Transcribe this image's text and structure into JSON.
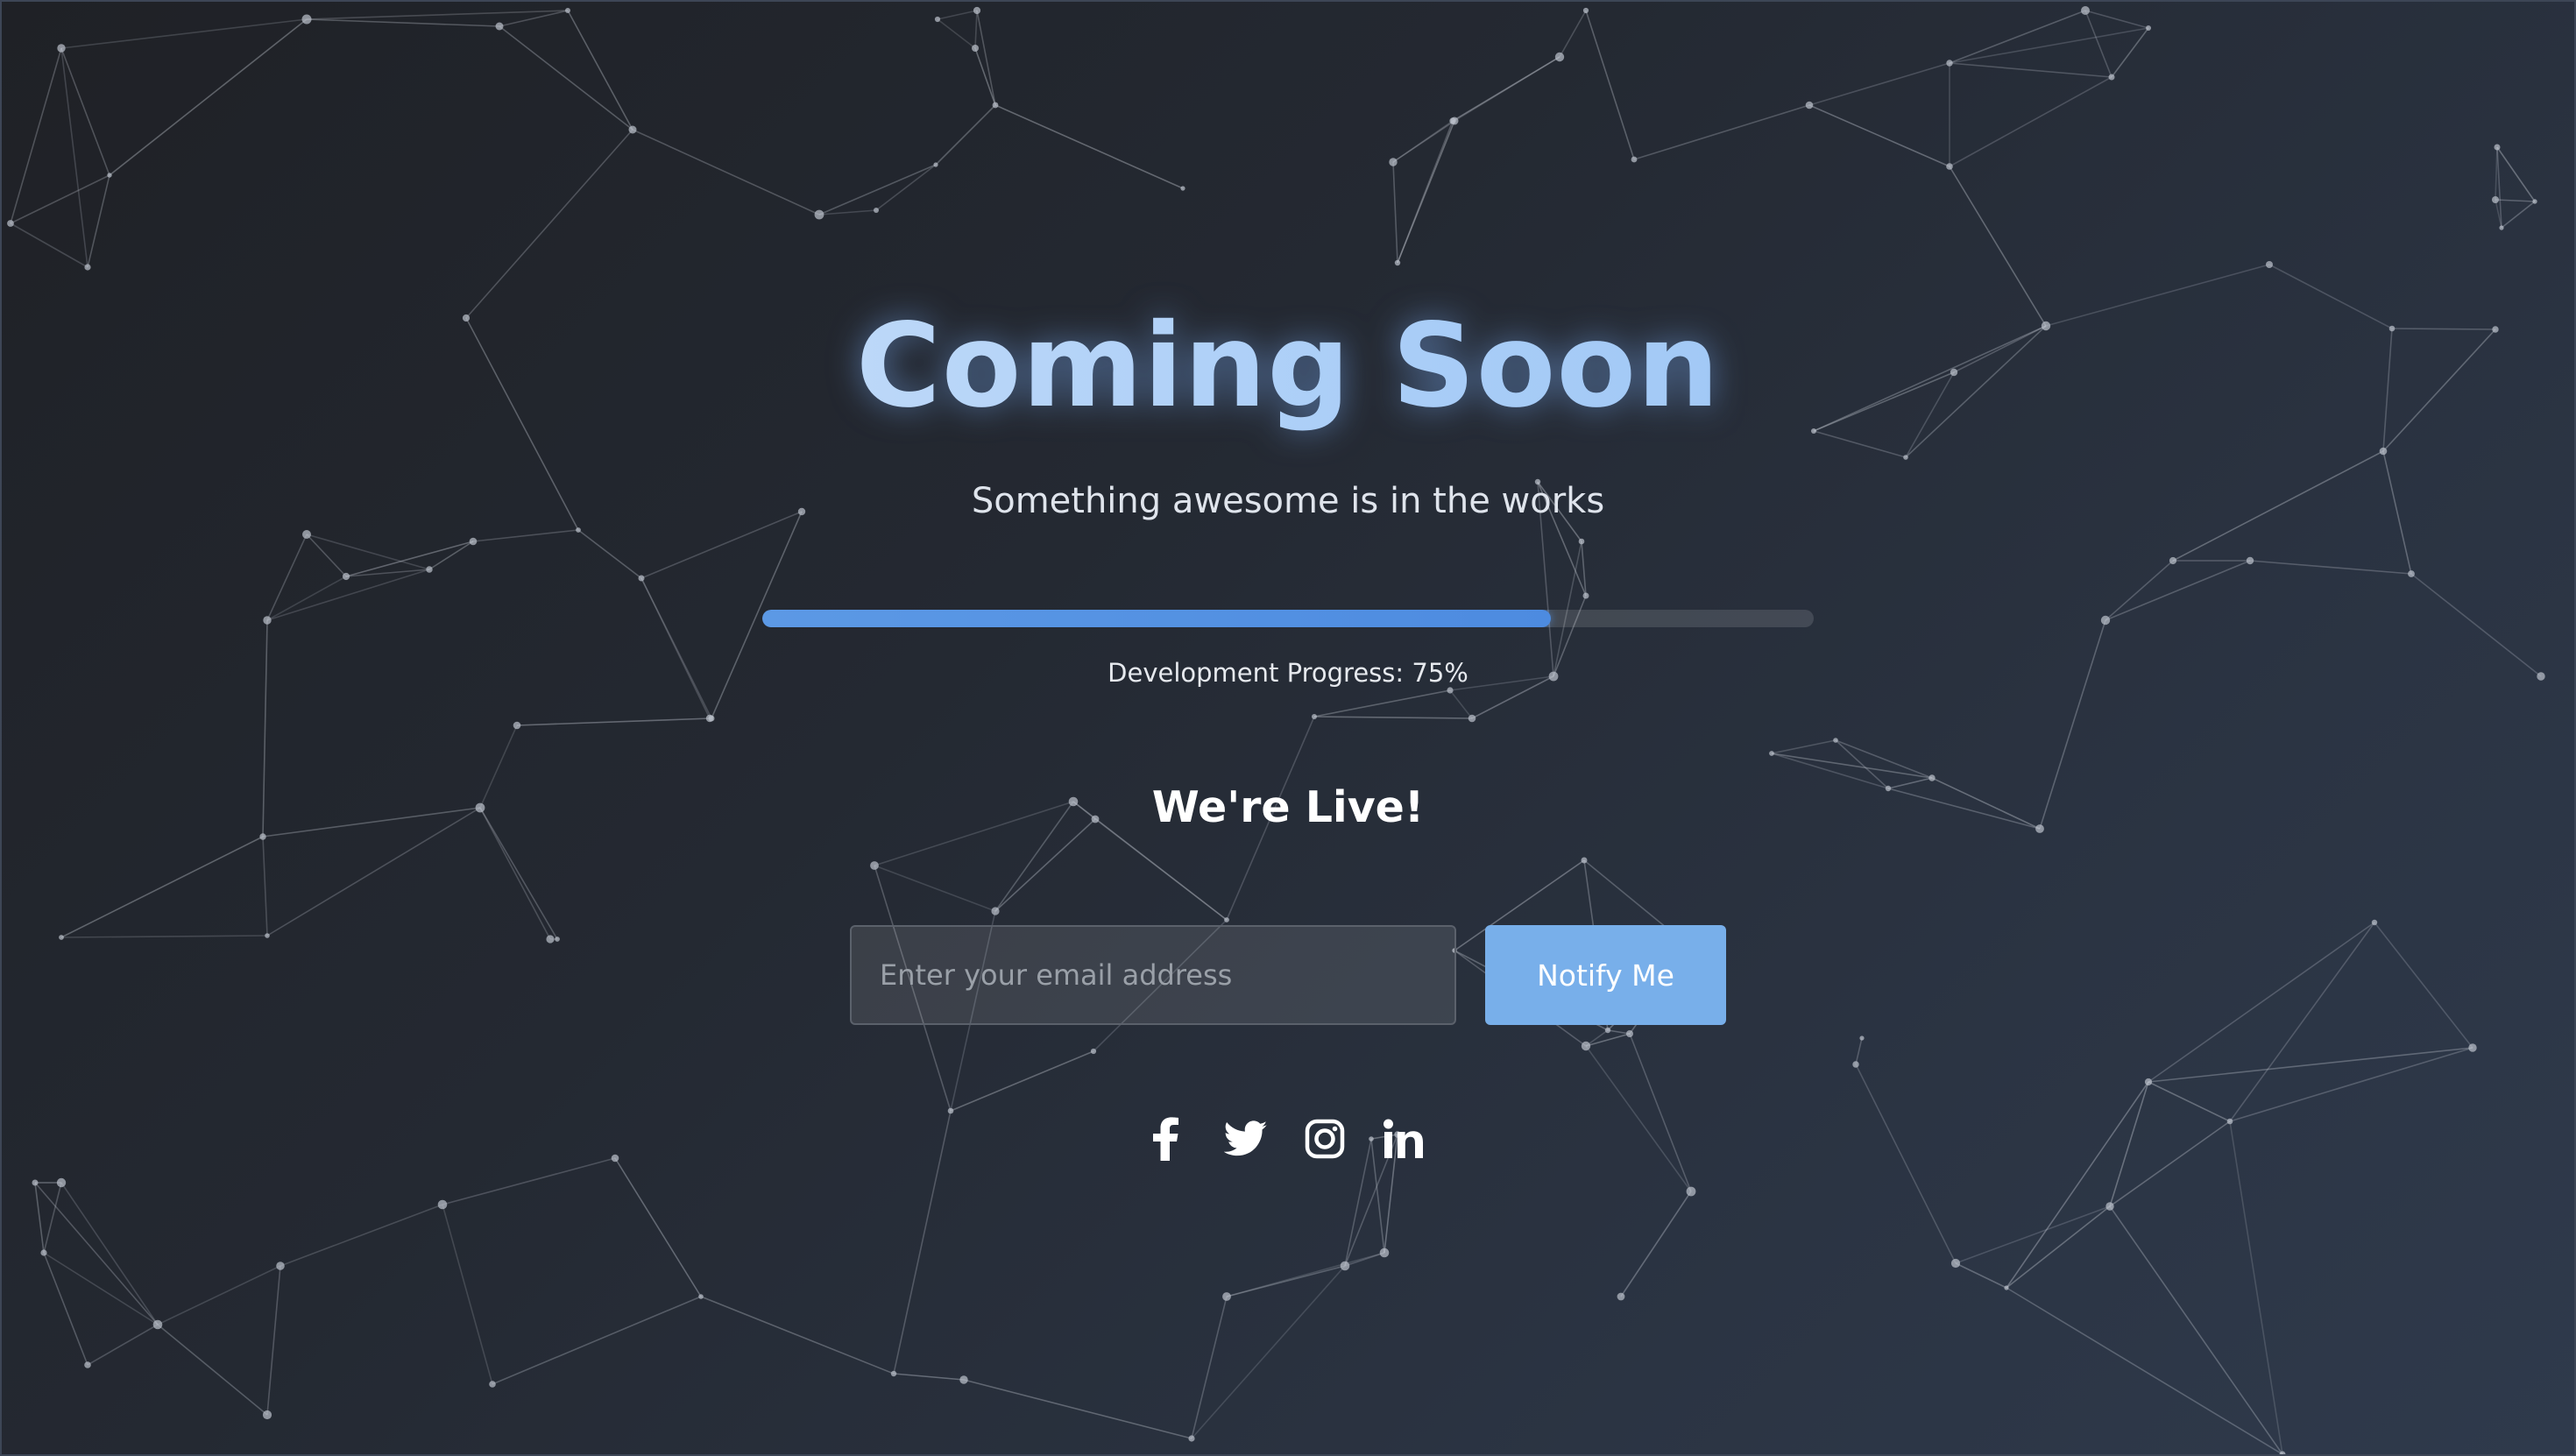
{
  "hero": {
    "title": "Coming Soon",
    "subtitle": "Something awesome is in the works"
  },
  "progress": {
    "value_percent": 75,
    "label": "Development Progress: 75%"
  },
  "status": {
    "heading": "We're Live!"
  },
  "signup": {
    "email_placeholder": "Enter your email address",
    "email_value": "",
    "button_label": "Notify Me"
  },
  "social": [
    {
      "icon": "facebook-icon"
    },
    {
      "icon": "twitter-icon"
    },
    {
      "icon": "instagram-icon"
    },
    {
      "icon": "linkedin-icon"
    }
  ],
  "colors": {
    "accent": "#78afea",
    "progress_fill": "#4d8be0",
    "title_glow": "#a9cdf7",
    "background_dark": "#1f2126",
    "background_light": "#2f3a4c"
  }
}
